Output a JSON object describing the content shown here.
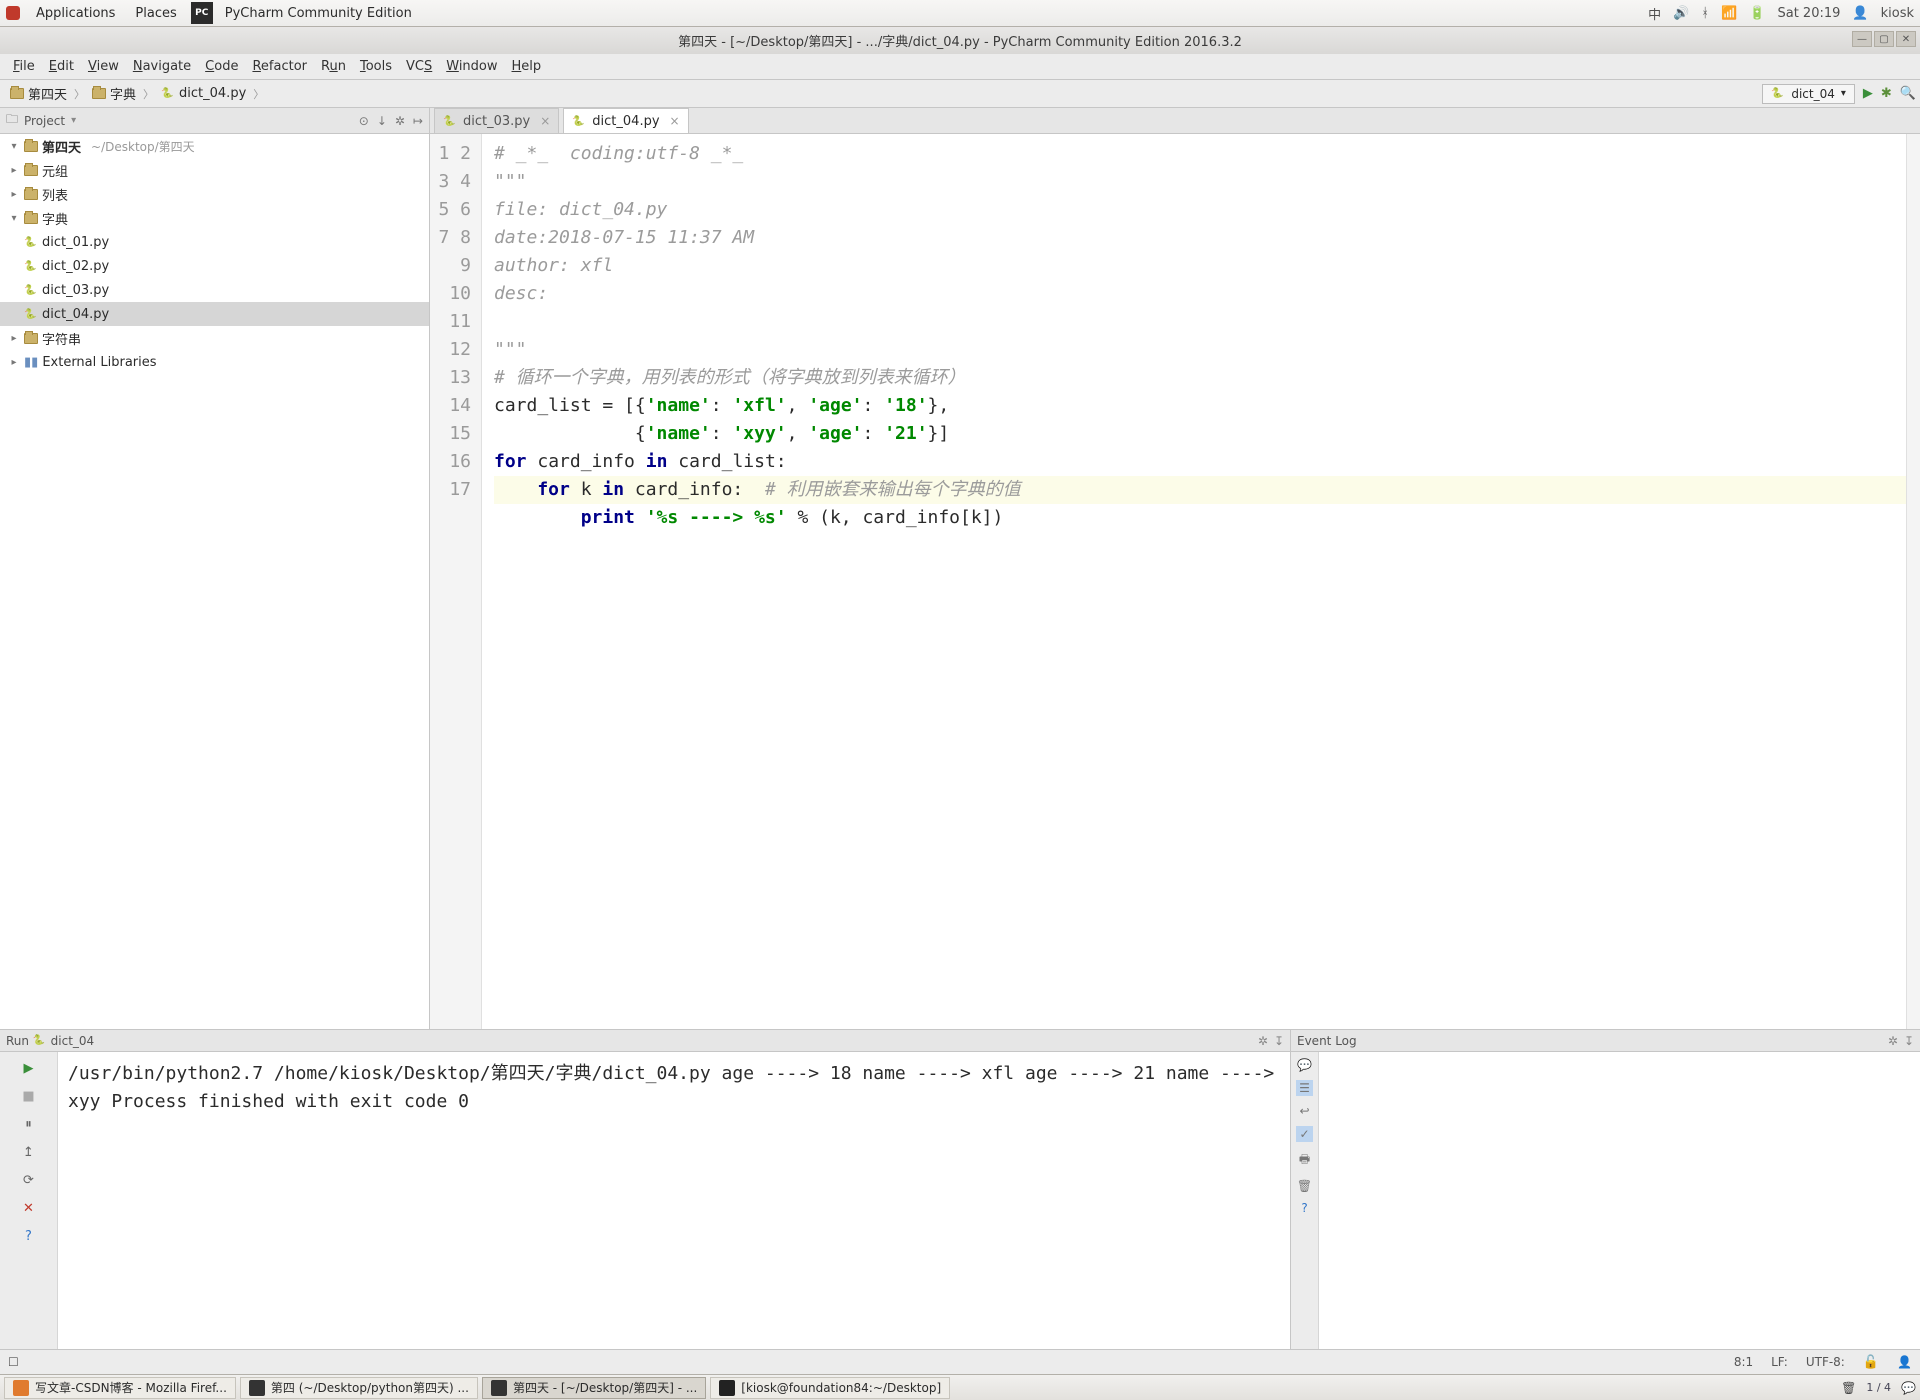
{
  "gnome": {
    "applications": "Applications",
    "places": "Places",
    "app_title": "PyCharm Community Edition",
    "ime": "中",
    "clock": "Sat 20:19",
    "user": "kiosk"
  },
  "window": {
    "title": "第四天 - [~/Desktop/第四天] - .../字典/dict_04.py - PyCharm Community Edition 2016.3.2"
  },
  "menubar": [
    "File",
    "Edit",
    "View",
    "Navigate",
    "Code",
    "Refactor",
    "Run",
    "Tools",
    "VCS",
    "Window",
    "Help"
  ],
  "breadcrumb": [
    "第四天",
    "字典",
    "dict_04.py"
  ],
  "run_config": "dict_04",
  "project_panel": {
    "title": "Project",
    "root": "第四天",
    "root_hint": "~/Desktop/第四天",
    "folders": {
      "tuple": "元组",
      "list": "列表",
      "dict": "字典",
      "str": "字符串"
    },
    "files": [
      "dict_01.py",
      "dict_02.py",
      "dict_03.py",
      "dict_04.py"
    ],
    "external": "External Libraries"
  },
  "tabs": [
    {
      "label": "dict_03.py",
      "active": false
    },
    {
      "label": "dict_04.py",
      "active": true
    }
  ],
  "code": {
    "lines": [
      "1",
      "2",
      "3",
      "4",
      "5",
      "6",
      "7",
      "8",
      "9",
      "10",
      "11",
      "12",
      "13",
      "14",
      "15",
      "16",
      "17"
    ],
    "l1": "# _*_  coding:utf-8 _*_",
    "l2": "\"\"\"",
    "l3": "file: dict_04.py",
    "l4": "date:2018-07-15 11:37 AM",
    "l5": "author: xfl",
    "l6": "desc:",
    "l7": "",
    "l8": "\"\"\"",
    "l9": "# 循环一个字典，用列表的形式（将字典放到列表来循环）",
    "l10_a": "card_list = [{",
    "l10_b": "'name'",
    "l10_c": ": ",
    "l10_d": "'xfl'",
    "l10_e": ", ",
    "l10_f": "'age'",
    "l10_g": ": ",
    "l10_h": "'18'",
    "l10_i": "},",
    "l11_a": "             {",
    "l11_b": "'name'",
    "l11_c": ": ",
    "l11_d": "'xyy'",
    "l11_e": ", ",
    "l11_f": "'age'",
    "l11_g": ": ",
    "l11_h": "'21'",
    "l11_i": "}]",
    "l12_a": "for",
    "l12_b": " card_info ",
    "l12_c": "in",
    "l12_d": " card_list:",
    "l13_a": "    for",
    "l13_b": " k ",
    "l13_c": "in",
    "l13_d": " card_info:  ",
    "l13_e": "# 利用嵌套来输出每个字典的值",
    "l14_a": "        print ",
    "l14_b": "'%s ----> %s'",
    "l14_c": " % (k, card_info[k])"
  },
  "run": {
    "title": "Run",
    "name": "dict_04",
    "out1": "/usr/bin/python2.7 /home/kiosk/Desktop/第四天/字典/dict_04.py",
    "out2": "age ----> 18",
    "out3": "name ----> xfl",
    "out4": "age ----> 21",
    "out5": "name ----> xyy",
    "out6": "",
    "out7": "Process finished with exit code 0"
  },
  "eventlog": {
    "title": "Event Log"
  },
  "status": {
    "pos": "8:1",
    "lf": "LF:",
    "enc": "UTF-8:"
  },
  "taskbar": {
    "t1": "写文章-CSDN博客 - Mozilla Firef...",
    "t2": "第四 (~/Desktop/python第四天) ...",
    "t3": "第四天 - [~/Desktop/第四天] - ...",
    "t4": "[kiosk@foundation84:~/Desktop]",
    "ws": "1 / 4"
  }
}
